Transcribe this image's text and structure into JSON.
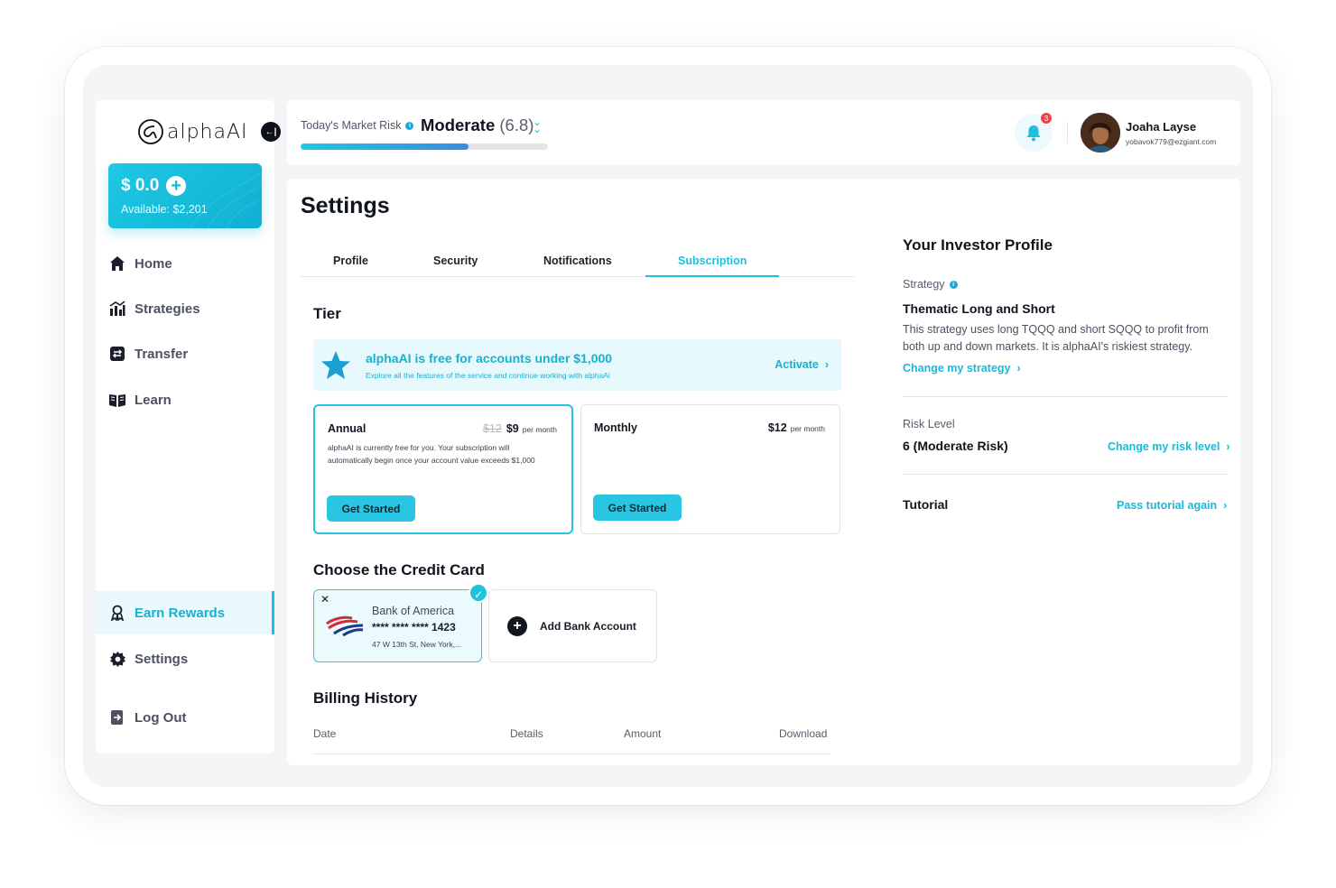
{
  "app": {
    "logo_text": "alphaAI",
    "collapse_icon": "collapse-icon"
  },
  "balance": {
    "amount": "$ 0.0",
    "available": "Available: $2,201"
  },
  "nav": {
    "items": [
      {
        "label": "Home",
        "icon": "home-icon"
      },
      {
        "label": "Strategies",
        "icon": "strategies-icon"
      },
      {
        "label": "Transfer",
        "icon": "transfer-icon"
      },
      {
        "label": "Learn",
        "icon": "book-icon"
      }
    ],
    "bottom": [
      {
        "label": "Earn Rewards",
        "icon": "rewards-icon",
        "active": true
      },
      {
        "label": "Settings",
        "icon": "gear-icon"
      },
      {
        "label": "Log Out",
        "icon": "logout-icon"
      }
    ]
  },
  "topbar": {
    "risk_label": "Today's Market Risk",
    "risk_value": "Moderate",
    "risk_score": "(6.8)",
    "risk_progress": 0.68,
    "notifications_count": "3",
    "user_name": "Joaha Layse",
    "user_email": "yobavok779@ezgiant.com"
  },
  "settings": {
    "title": "Settings",
    "tabs": [
      "Profile",
      "Security",
      "Notifications",
      "Subscription"
    ],
    "active_tab": "Subscription",
    "tier_title": "Tier",
    "promo": {
      "title": "alphaAI is free for accounts under $1,000",
      "subtitle": "Explore all the features of the service and continue working with alphaAi",
      "action": "Activate"
    },
    "plans": [
      {
        "name": "Annual",
        "old_price": "$12",
        "price": "$9",
        "per": "per month",
        "description": "alphaAI is currently free for you. Your subscription will automatically begin once your account value exceeds $1,000",
        "button": "Get Started",
        "selected": true
      },
      {
        "name": "Monthly",
        "old_price": "",
        "price": "$12",
        "per": "per month",
        "description": "",
        "button": "Get Started",
        "selected": false
      }
    ],
    "credit_title": "Choose the Credit Card",
    "card": {
      "bank": "Bank of America",
      "number": "**** **** **** 1423",
      "address": "47 W 13th St, New York,..."
    },
    "add_bank": "Add Bank Account",
    "billing_title": "Billing History",
    "billing_columns": [
      "Date",
      "Details",
      "Amount",
      "Download"
    ]
  },
  "investor_profile": {
    "title": "Your Investor Profile",
    "strategy_label": "Strategy",
    "strategy_name": "Thematic Long and Short",
    "strategy_desc": "This strategy uses long TQQQ and short SQQQ to profit from both up and down markets. It is alphaAI's riskiest strategy.",
    "change_strategy": "Change my strategy",
    "risk_label": "Risk Level",
    "risk_value": "6 (Moderate Risk)",
    "change_risk": "Change my risk level",
    "tutorial_label": "Tutorial",
    "tutorial_action": "Pass tutorial again"
  },
  "colors": {
    "accent": "#1fbfde",
    "dark": "#10141e",
    "badge": "#ef4444"
  }
}
